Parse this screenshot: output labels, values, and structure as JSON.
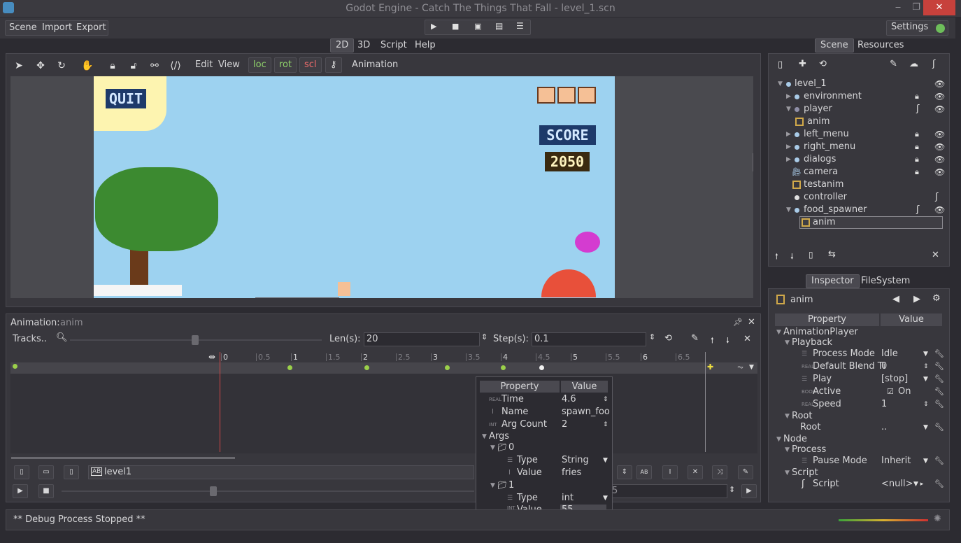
{
  "window": {
    "title": "Godot Engine - Catch The Things That Fall - level_1.scn",
    "minimize": "‒",
    "maximize": "❐",
    "close": "✕"
  },
  "menu": {
    "scene": "Scene",
    "import": "Import",
    "export": "Export",
    "settings": "Settings"
  },
  "main_tabs": [
    "2D",
    "3D",
    "Script",
    "Help"
  ],
  "viewport_toolbar": {
    "edit": "Edit",
    "view": "View",
    "loc": "loc",
    "rot": "rot",
    "scl": "scl",
    "animation": "Animation"
  },
  "game": {
    "quit": "QUIT",
    "score_label": "SCORE",
    "score_value": "2050"
  },
  "scene_dock": {
    "tabs": [
      "Scene",
      "Resources"
    ],
    "nodes": [
      {
        "name": "level_1"
      },
      {
        "name": "environment"
      },
      {
        "name": "player"
      },
      {
        "name": "anim"
      },
      {
        "name": "left_menu"
      },
      {
        "name": "right_menu"
      },
      {
        "name": "dialogs"
      },
      {
        "name": "camera"
      },
      {
        "name": "testanim"
      },
      {
        "name": "controller"
      },
      {
        "name": "food_spawner"
      },
      {
        "name": "anim"
      }
    ]
  },
  "inspector": {
    "tabs": [
      "Inspector",
      "FileSystem"
    ],
    "object": "anim",
    "header": {
      "property": "Property",
      "value": "Value"
    },
    "rows": [
      {
        "label": "AnimationPlayer"
      },
      {
        "label": "Playback"
      },
      {
        "label": "Process Mode",
        "value": "Idle"
      },
      {
        "label": "Default Blend Ti",
        "value": "0",
        "tag": "REAL"
      },
      {
        "label": "Play",
        "value": "[stop]"
      },
      {
        "label": "Active",
        "value": "On",
        "tag": "BOOL"
      },
      {
        "label": "Speed",
        "value": "1",
        "tag": "REAL"
      },
      {
        "label": "Root"
      },
      {
        "label": "Root",
        "value": ".."
      },
      {
        "label": "Node"
      },
      {
        "label": "Process"
      },
      {
        "label": "Pause Mode",
        "value": "Inherit"
      },
      {
        "label": "Script"
      },
      {
        "label": "Script",
        "value": "<null>"
      }
    ]
  },
  "animation_panel": {
    "label": "Animation:",
    "name": "anim",
    "tracks": "Tracks..",
    "len_label": "Len(s):",
    "len_value": "20",
    "step_label": "Step(s):",
    "step_value": "0.1",
    "ruler": [
      "0",
      "0.5",
      "1",
      "1.5",
      "2",
      "2.5",
      "3",
      "3.5",
      "4",
      "4.5",
      "5",
      "5.5",
      "6",
      "6.5"
    ],
    "key_times": [
      1,
      2.1,
      3.25,
      4.05,
      4.6
    ],
    "anim_name": "level1",
    "right_value": "5"
  },
  "popup": {
    "header": {
      "property": "Property",
      "value": "Value"
    },
    "time_label": "Time",
    "time_value": "4.6",
    "name_label": "Name",
    "name_value": "spawn_foo",
    "argcount_label": "Arg Count",
    "argcount_value": "2",
    "args_label": "Args",
    "arg0": "0",
    "arg0_type_label": "Type",
    "arg0_type": "String",
    "arg0_value_label": "Value",
    "arg0_value": "fries",
    "arg1": "1",
    "arg1_type_label": "Type",
    "arg1_type": "int",
    "arg1_value_label": "Value",
    "arg1_value": "55"
  },
  "status": {
    "text": "** Debug Process Stopped **"
  }
}
